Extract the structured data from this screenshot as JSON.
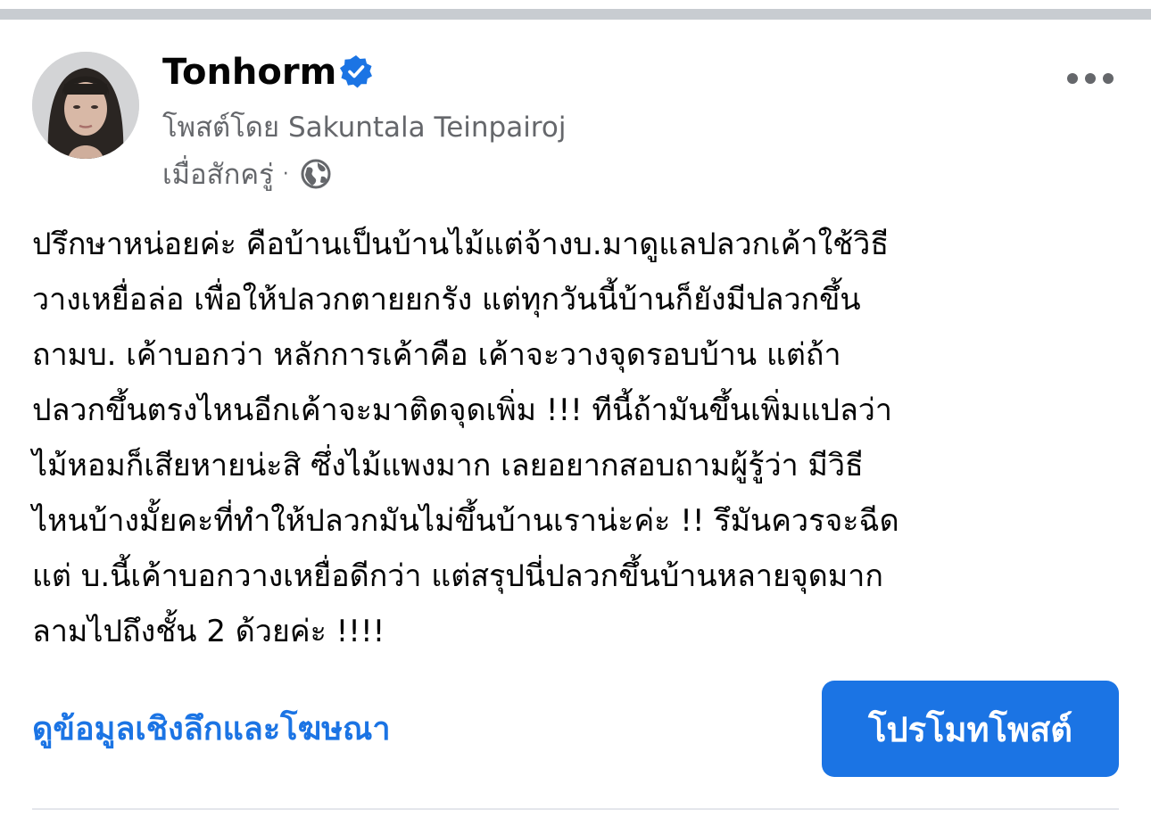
{
  "post": {
    "page_name": "Tonhorm",
    "posted_by": "โพสต์โดย Sakuntala Teinpairoj",
    "timestamp": "เมื่อสักครู่",
    "separator": "·",
    "privacy_icon": "globe-icon",
    "verified_icon": "verified-badge-icon",
    "more_icon": "more-horizontal-icon",
    "body_lines": [
      "ปรึกษาหน่อยค่ะ คือบ้านเป็นบ้านไม้แต่จ้างบ.มาดูแลปลวกเค้าใช้วิธี",
      "วางเหยื่อล่อ เพื่อให้ปลวกตายยกรัง แต่ทุกวันนี้บ้านก็ยังมีปลวกขึ้น",
      "ถามบ. เค้าบอกว่า หลักการเค้าคือ เค้าจะวางจุดรอบบ้าน แต่ถ้า",
      "ปลวกขึ้นตรงไหนอีกเค้าจะมาติดจุดเพิ่ม !!! ทีนี้ถ้ามันขึ้นเพิ่มแปลว่า",
      "ไม้หอมก็เสียหายน่ะสิ ซึ่งไม้แพงมาก เลยอยากสอบถามผู้รู้ว่า มีวิธี",
      "ไหนบ้างมั้ยคะที่ทำให้ปลวกมันไม่ขึ้นบ้านเราน่ะค่ะ !! รึมันควรจะฉีด",
      "แต่ บ.นี้เค้าบอกวางเหยื่อดีกว่า แต่สรุปนี่ปลวกขึ้นบ้านหลายจุดมาก",
      "ลามไปถึงชั้น 2 ด้วยค่ะ !!!!"
    ]
  },
  "actions": {
    "insights_label": "ดูข้อมูลเชิงลึกและโฆษณา",
    "promote_label": "โปรโมทโพสต์"
  },
  "colors": {
    "accent": "#1b74e4",
    "secondary_text": "#65676b",
    "primary_text": "#050505"
  }
}
